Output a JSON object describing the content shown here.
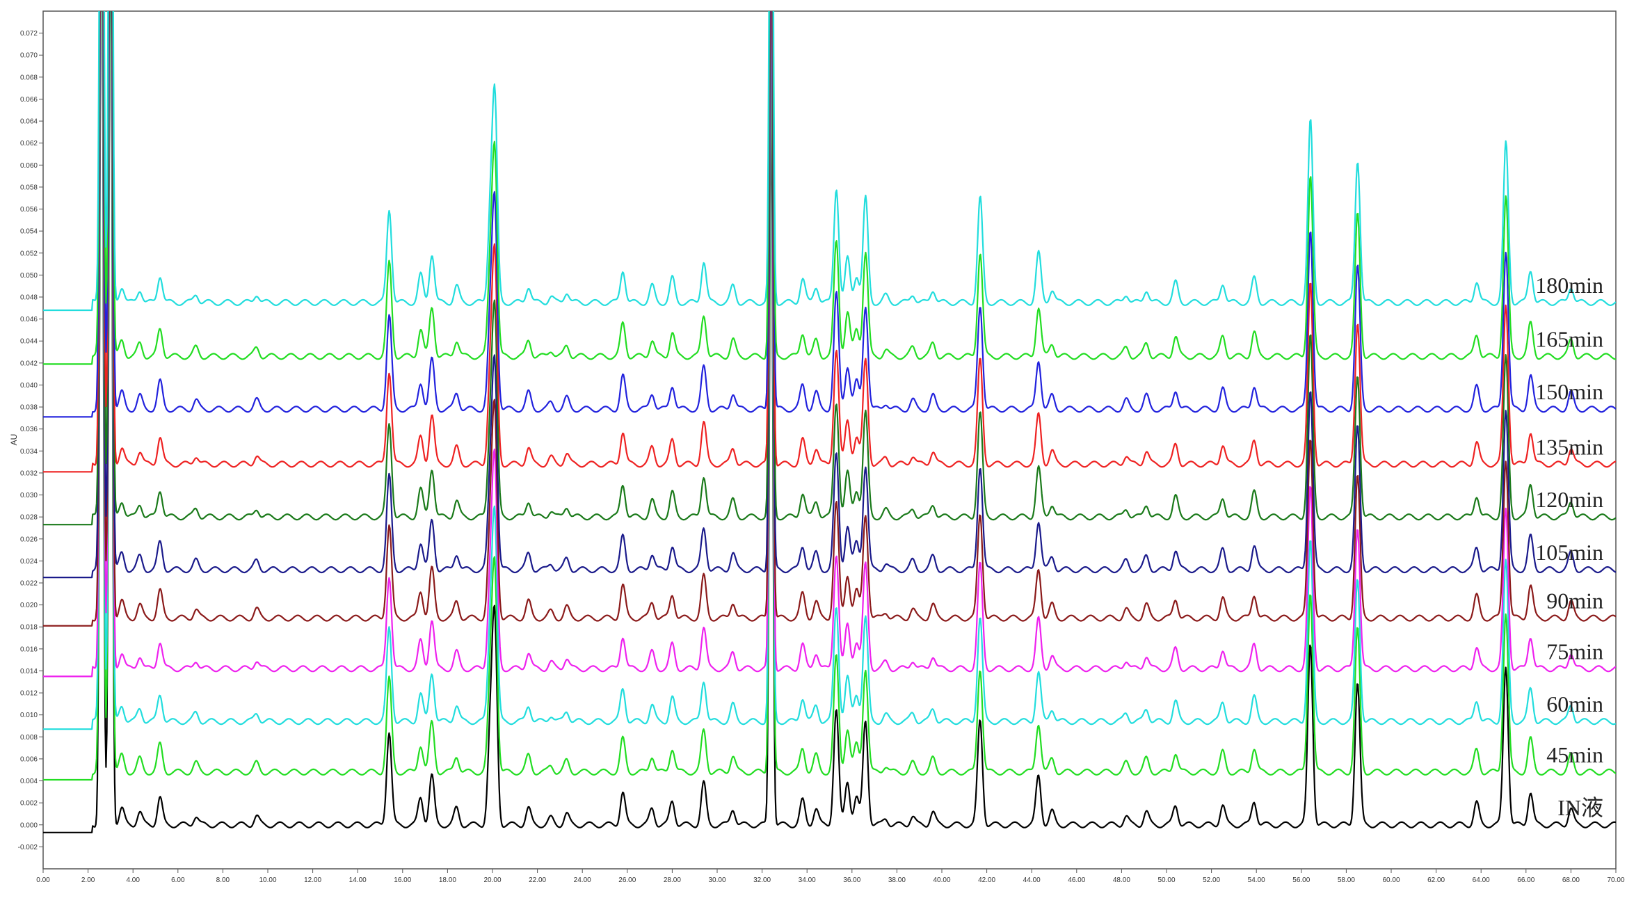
{
  "chart_data": {
    "type": "line",
    "title": "",
    "xlabel": "",
    "ylabel": "AU",
    "xlim": [
      0,
      70
    ],
    "ylim": [
      -0.004,
      0.074
    ],
    "x_ticks": [
      "0.00",
      "2.00",
      "4.00",
      "6.00",
      "8.00",
      "10.00",
      "12.00",
      "14.00",
      "16.00",
      "18.00",
      "20.00",
      "22.00",
      "24.00",
      "26.00",
      "28.00",
      "30.00",
      "32.00",
      "34.00",
      "36.00",
      "38.00",
      "40.00",
      "42.00",
      "44.00",
      "46.00",
      "48.00",
      "50.00",
      "52.00",
      "54.00",
      "56.00",
      "58.00",
      "60.00",
      "62.00",
      "64.00",
      "66.00",
      "68.00",
      "70.00"
    ],
    "y_ticks": [
      "-0.002",
      "0.000",
      "0.002",
      "0.004",
      "0.006",
      "0.008",
      "0.010",
      "0.012",
      "0.014",
      "0.016",
      "0.018",
      "0.020",
      "0.022",
      "0.024",
      "0.026",
      "0.028",
      "0.030",
      "0.032",
      "0.034",
      "0.036",
      "0.038",
      "0.040",
      "0.042",
      "0.044",
      "0.046",
      "0.048",
      "0.050",
      "0.052",
      "0.054",
      "0.056",
      "0.058",
      "0.060",
      "0.062",
      "0.064",
      "0.066",
      "0.068",
      "0.070",
      "0.072"
    ],
    "grid": false,
    "legend": "labels at right end of each trace",
    "peaks": [
      {
        "rt": 2.6,
        "height": 0.09
      },
      {
        "rt": 3.0,
        "height": 0.085
      },
      {
        "rt": 3.5,
        "height": 0.0015
      },
      {
        "rt": 4.3,
        "height": 0.0012
      },
      {
        "rt": 5.2,
        "height": 0.0025
      },
      {
        "rt": 6.8,
        "height": 0.0008
      },
      {
        "rt": 9.5,
        "height": 0.0008
      },
      {
        "rt": 15.4,
        "height": 0.0085
      },
      {
        "rt": 16.8,
        "height": 0.0025
      },
      {
        "rt": 17.3,
        "height": 0.0045
      },
      {
        "rt": 18.4,
        "height": 0.0015
      },
      {
        "rt": 19.9,
        "height": 0.008
      },
      {
        "rt": 20.1,
        "height": 0.018
      },
      {
        "rt": 21.6,
        "height": 0.0015
      },
      {
        "rt": 22.6,
        "height": 0.0006
      },
      {
        "rt": 23.3,
        "height": 0.001
      },
      {
        "rt": 25.8,
        "height": 0.003
      },
      {
        "rt": 27.1,
        "height": 0.0015
      },
      {
        "rt": 28.0,
        "height": 0.0022
      },
      {
        "rt": 29.4,
        "height": 0.0038
      },
      {
        "rt": 30.7,
        "height": 0.0015
      },
      {
        "rt": 32.4,
        "height": 0.066
      },
      {
        "rt": 33.8,
        "height": 0.0022
      },
      {
        "rt": 34.4,
        "height": 0.0015
      },
      {
        "rt": 35.3,
        "height": 0.0105
      },
      {
        "rt": 35.8,
        "height": 0.004
      },
      {
        "rt": 36.2,
        "height": 0.0025
      },
      {
        "rt": 36.6,
        "height": 0.0095
      },
      {
        "rt": 37.5,
        "height": 0.0006
      },
      {
        "rt": 38.7,
        "height": 0.0008
      },
      {
        "rt": 39.6,
        "height": 0.0012
      },
      {
        "rt": 41.7,
        "height": 0.0095
      },
      {
        "rt": 44.3,
        "height": 0.0045
      },
      {
        "rt": 44.9,
        "height": 0.0012
      },
      {
        "rt": 48.2,
        "height": 0.0008
      },
      {
        "rt": 49.1,
        "height": 0.0012
      },
      {
        "rt": 50.4,
        "height": 0.0018
      },
      {
        "rt": 52.5,
        "height": 0.0018
      },
      {
        "rt": 53.9,
        "height": 0.0022
      },
      {
        "rt": 56.4,
        "height": 0.0165
      },
      {
        "rt": 58.5,
        "height": 0.013
      },
      {
        "rt": 63.8,
        "height": 0.002
      },
      {
        "rt": 65.1,
        "height": 0.0145
      },
      {
        "rt": 66.2,
        "height": 0.003
      },
      {
        "rt": 68.0,
        "height": 0.0015
      }
    ],
    "series": [
      {
        "name": "IN液",
        "color": "#000000",
        "baseline": 0.0
      },
      {
        "name": "45min",
        "color": "#22dd22",
        "baseline": 0.0048
      },
      {
        "name": "60min",
        "color": "#22dddd",
        "baseline": 0.0094
      },
      {
        "name": "75min",
        "color": "#ee22ee",
        "baseline": 0.0142
      },
      {
        "name": "90min",
        "color": "#8b1a1a",
        "baseline": 0.0188
      },
      {
        "name": "105min",
        "color": "#1a1a8b",
        "baseline": 0.0232
      },
      {
        "name": "120min",
        "color": "#1a7a1a",
        "baseline": 0.028
      },
      {
        "name": "135min",
        "color": "#ee2222",
        "baseline": 0.0328
      },
      {
        "name": "150min",
        "color": "#2222dd",
        "baseline": 0.0378
      },
      {
        "name": "165min",
        "color": "#22dd22",
        "baseline": 0.0426
      },
      {
        "name": "180min",
        "color": "#22dddd",
        "baseline": 0.0475
      }
    ]
  }
}
